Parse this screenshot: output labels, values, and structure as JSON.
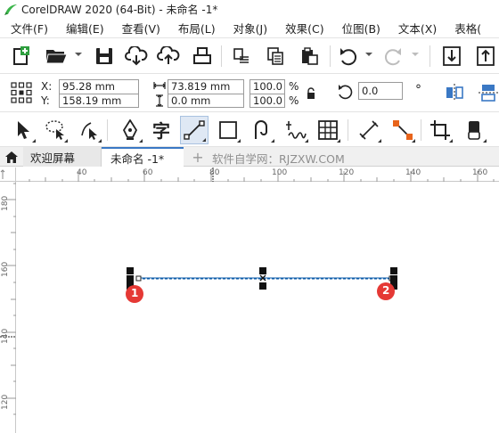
{
  "window": {
    "title": "CorelDRAW 2020 (64-Bit) - 未命名 -1*"
  },
  "menu": [
    {
      "label": "文件(F)"
    },
    {
      "label": "编辑(E)"
    },
    {
      "label": "查看(V)"
    },
    {
      "label": "布局(L)"
    },
    {
      "label": "对象(J)"
    },
    {
      "label": "效果(C)"
    },
    {
      "label": "位图(B)"
    },
    {
      "label": "文本(X)"
    },
    {
      "label": "表格("
    }
  ],
  "property_bar": {
    "x_label": "X:",
    "x_value": "95.28 mm",
    "y_label": "Y:",
    "y_value": "158.19 mm",
    "width_value": "73.819 mm",
    "height_value": "0.0 mm",
    "scale_x": "100.0",
    "scale_y": "100.0",
    "pct1": "%",
    "pct2": "%",
    "rotation_value": "0.0",
    "degree_symbol": "°"
  },
  "tabs": {
    "welcome": "欢迎屏幕",
    "document": "未命名 -1*",
    "add": "+",
    "watermark": "软件自学网：RJZXW.COM"
  },
  "rulers": {
    "horizontal": [
      "40",
      "60",
      "80",
      "100",
      "120",
      "140",
      "160"
    ],
    "vertical": [
      "180",
      "160",
      "140",
      "120"
    ]
  },
  "canvas": {
    "markers": [
      "1",
      "2"
    ],
    "marker_color": "#e53935",
    "line_color": "#0a5aa8"
  },
  "icons": {
    "logo": "coreldraw-logo-icon",
    "home": "home-icon"
  }
}
